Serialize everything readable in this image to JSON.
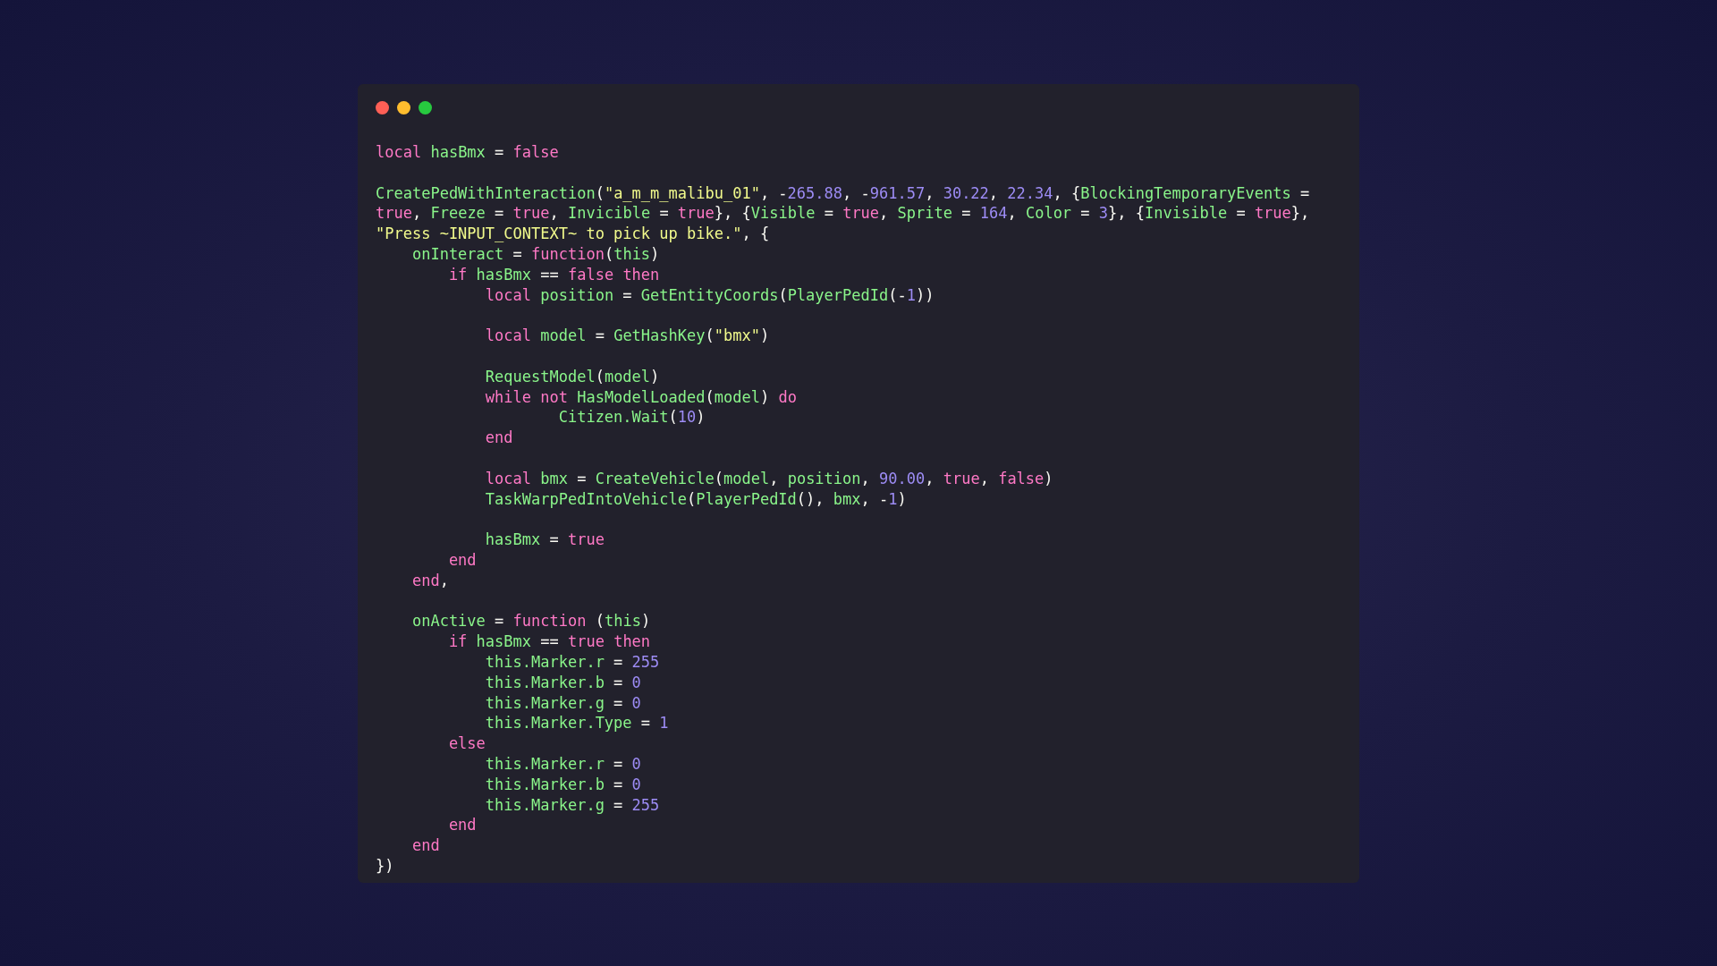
{
  "window": {
    "controls": [
      {
        "color": "#ff5f56"
      },
      {
        "color": "#ffbd2e"
      },
      {
        "color": "#27c93f"
      }
    ]
  },
  "code": {
    "blocks": [
      {
        "lines": [
          {
            "tokens": [
              {
                "kind": "kw",
                "text": "local "
              },
              {
                "kind": "id",
                "text": "hasBmx"
              },
              {
                "kind": "op",
                "text": " = "
              },
              {
                "kind": "kw",
                "text": "false"
              }
            ]
          }
        ]
      },
      {
        "lines": [
          {
            "tokens": [
              {
                "kind": "id",
                "text": "CreatePedWithInteraction"
              },
              {
                "kind": "op",
                "text": "("
              },
              {
                "kind": "str",
                "text": "\"a_m_m_malibu_01\""
              },
              {
                "kind": "op",
                "text": ", -"
              },
              {
                "kind": "num",
                "text": "265.88"
              },
              {
                "kind": "op",
                "text": ", -"
              },
              {
                "kind": "num",
                "text": "961.57"
              },
              {
                "kind": "op",
                "text": ", "
              },
              {
                "kind": "num",
                "text": "30.22"
              },
              {
                "kind": "op",
                "text": ", "
              },
              {
                "kind": "num",
                "text": "22.34"
              },
              {
                "kind": "op",
                "text": ", {"
              },
              {
                "kind": "id",
                "text": "BlockingTemporaryEvents"
              },
              {
                "kind": "op",
                "text": " ="
              }
            ]
          },
          {
            "tokens": [
              {
                "kind": "kw",
                "text": "true"
              },
              {
                "kind": "op",
                "text": ", "
              },
              {
                "kind": "id",
                "text": "Freeze"
              },
              {
                "kind": "op",
                "text": " = "
              },
              {
                "kind": "kw",
                "text": "true"
              },
              {
                "kind": "op",
                "text": ", "
              },
              {
                "kind": "id",
                "text": "Invicible"
              },
              {
                "kind": "op",
                "text": " = "
              },
              {
                "kind": "kw",
                "text": "true"
              },
              {
                "kind": "op",
                "text": "}, {"
              },
              {
                "kind": "id",
                "text": "Visible"
              },
              {
                "kind": "op",
                "text": " = "
              },
              {
                "kind": "kw",
                "text": "true"
              },
              {
                "kind": "op",
                "text": ", "
              },
              {
                "kind": "id",
                "text": "Sprite"
              },
              {
                "kind": "op",
                "text": " = "
              },
              {
                "kind": "num",
                "text": "164"
              },
              {
                "kind": "op",
                "text": ", "
              },
              {
                "kind": "id",
                "text": "Color"
              },
              {
                "kind": "op",
                "text": " = "
              },
              {
                "kind": "num",
                "text": "3"
              },
              {
                "kind": "op",
                "text": "}, {"
              },
              {
                "kind": "id",
                "text": "Invisible"
              },
              {
                "kind": "op",
                "text": " = "
              },
              {
                "kind": "kw",
                "text": "true"
              },
              {
                "kind": "op",
                "text": "},"
              }
            ]
          },
          {
            "tokens": [
              {
                "kind": "str",
                "text": "\"Press ~INPUT_CONTEXT~ to pick up bike.\""
              },
              {
                "kind": "op",
                "text": ", {"
              }
            ]
          },
          {
            "tokens": [
              {
                "kind": "id",
                "text": "    onInteract"
              },
              {
                "kind": "op",
                "text": " = "
              },
              {
                "kind": "kw",
                "text": "function"
              },
              {
                "kind": "op",
                "text": "("
              },
              {
                "kind": "id",
                "text": "this"
              },
              {
                "kind": "op",
                "text": ")"
              }
            ]
          },
          {
            "tokens": [
              {
                "kind": "kw",
                "text": "        if "
              },
              {
                "kind": "id",
                "text": "hasBmx"
              },
              {
                "kind": "op",
                "text": " == "
              },
              {
                "kind": "kw",
                "text": "false then"
              }
            ]
          },
          {
            "tokens": [
              {
                "kind": "kw",
                "text": "            local "
              },
              {
                "kind": "id",
                "text": "position"
              },
              {
                "kind": "op",
                "text": " = "
              },
              {
                "kind": "id",
                "text": "GetEntityCoords"
              },
              {
                "kind": "op",
                "text": "("
              },
              {
                "kind": "id",
                "text": "PlayerPedId"
              },
              {
                "kind": "op",
                "text": "(-"
              },
              {
                "kind": "num",
                "text": "1"
              },
              {
                "kind": "op",
                "text": "))"
              }
            ]
          }
        ]
      },
      {
        "lines": [
          {
            "tokens": [
              {
                "kind": "kw",
                "text": "            local "
              },
              {
                "kind": "id",
                "text": "model"
              },
              {
                "kind": "op",
                "text": " = "
              },
              {
                "kind": "id",
                "text": "GetHashKey"
              },
              {
                "kind": "op",
                "text": "("
              },
              {
                "kind": "str",
                "text": "\"bmx\""
              },
              {
                "kind": "op",
                "text": ")"
              }
            ]
          }
        ]
      },
      {
        "lines": [
          {
            "tokens": [
              {
                "kind": "id",
                "text": "            RequestModel"
              },
              {
                "kind": "op",
                "text": "("
              },
              {
                "kind": "id",
                "text": "model"
              },
              {
                "kind": "op",
                "text": ")"
              }
            ]
          },
          {
            "tokens": [
              {
                "kind": "kw",
                "text": "            while not "
              },
              {
                "kind": "id",
                "text": "HasModelLoaded"
              },
              {
                "kind": "op",
                "text": "("
              },
              {
                "kind": "id",
                "text": "model"
              },
              {
                "kind": "op",
                "text": ") "
              },
              {
                "kind": "kw",
                "text": "do"
              }
            ]
          },
          {
            "tokens": [
              {
                "kind": "id",
                "text": "                    Citizen.Wait"
              },
              {
                "kind": "op",
                "text": "("
              },
              {
                "kind": "num",
                "text": "10"
              },
              {
                "kind": "op",
                "text": ")"
              }
            ]
          },
          {
            "tokens": [
              {
                "kind": "kw",
                "text": "            end"
              }
            ]
          }
        ]
      },
      {
        "lines": [
          {
            "tokens": [
              {
                "kind": "kw",
                "text": "            local "
              },
              {
                "kind": "id",
                "text": "bmx"
              },
              {
                "kind": "op",
                "text": " = "
              },
              {
                "kind": "id",
                "text": "CreateVehicle"
              },
              {
                "kind": "op",
                "text": "("
              },
              {
                "kind": "id",
                "text": "model"
              },
              {
                "kind": "op",
                "text": ", "
              },
              {
                "kind": "id",
                "text": "position"
              },
              {
                "kind": "op",
                "text": ", "
              },
              {
                "kind": "num",
                "text": "90.00"
              },
              {
                "kind": "op",
                "text": ", "
              },
              {
                "kind": "kw",
                "text": "true"
              },
              {
                "kind": "op",
                "text": ", "
              },
              {
                "kind": "kw",
                "text": "false"
              },
              {
                "kind": "op",
                "text": ")"
              }
            ]
          },
          {
            "tokens": [
              {
                "kind": "id",
                "text": "            TaskWarpPedIntoVehicle"
              },
              {
                "kind": "op",
                "text": "("
              },
              {
                "kind": "id",
                "text": "PlayerPedId"
              },
              {
                "kind": "op",
                "text": "(), "
              },
              {
                "kind": "id",
                "text": "bmx"
              },
              {
                "kind": "op",
                "text": ", -"
              },
              {
                "kind": "num",
                "text": "1"
              },
              {
                "kind": "op",
                "text": ")"
              }
            ]
          }
        ]
      },
      {
        "lines": [
          {
            "tokens": [
              {
                "kind": "id",
                "text": "            hasBmx"
              },
              {
                "kind": "op",
                "text": " = "
              },
              {
                "kind": "kw",
                "text": "true"
              }
            ]
          },
          {
            "tokens": [
              {
                "kind": "kw",
                "text": "        end"
              }
            ]
          },
          {
            "tokens": [
              {
                "kind": "kw",
                "text": "    end"
              },
              {
                "kind": "op",
                "text": ","
              }
            ]
          }
        ]
      },
      {
        "lines": [
          {
            "tokens": [
              {
                "kind": "id",
                "text": "    onActive"
              },
              {
                "kind": "op",
                "text": " = "
              },
              {
                "kind": "kw",
                "text": "function"
              },
              {
                "kind": "op",
                "text": " ("
              },
              {
                "kind": "id",
                "text": "this"
              },
              {
                "kind": "op",
                "text": ")"
              }
            ]
          },
          {
            "tokens": [
              {
                "kind": "kw",
                "text": "        if "
              },
              {
                "kind": "id",
                "text": "hasBmx"
              },
              {
                "kind": "op",
                "text": " == "
              },
              {
                "kind": "kw",
                "text": "true then"
              }
            ]
          },
          {
            "tokens": [
              {
                "kind": "id",
                "text": "            this.Marker.r"
              },
              {
                "kind": "op",
                "text": " = "
              },
              {
                "kind": "num",
                "text": "255"
              }
            ]
          },
          {
            "tokens": [
              {
                "kind": "id",
                "text": "            this.Marker.b"
              },
              {
                "kind": "op",
                "text": " = "
              },
              {
                "kind": "num",
                "text": "0"
              }
            ]
          },
          {
            "tokens": [
              {
                "kind": "id",
                "text": "            this.Marker.g"
              },
              {
                "kind": "op",
                "text": " = "
              },
              {
                "kind": "num",
                "text": "0"
              }
            ]
          },
          {
            "tokens": [
              {
                "kind": "id",
                "text": "            this.Marker.Type"
              },
              {
                "kind": "op",
                "text": " = "
              },
              {
                "kind": "num",
                "text": "1"
              }
            ]
          },
          {
            "tokens": [
              {
                "kind": "kw",
                "text": "        else"
              }
            ]
          },
          {
            "tokens": [
              {
                "kind": "id",
                "text": "            this.Marker.r"
              },
              {
                "kind": "op",
                "text": " = "
              },
              {
                "kind": "num",
                "text": "0"
              }
            ]
          },
          {
            "tokens": [
              {
                "kind": "id",
                "text": "            this.Marker.b"
              },
              {
                "kind": "op",
                "text": " = "
              },
              {
                "kind": "num",
                "text": "0"
              }
            ]
          },
          {
            "tokens": [
              {
                "kind": "id",
                "text": "            this.Marker.g"
              },
              {
                "kind": "op",
                "text": " = "
              },
              {
                "kind": "num",
                "text": "255"
              }
            ]
          },
          {
            "tokens": [
              {
                "kind": "kw",
                "text": "        end"
              }
            ]
          },
          {
            "tokens": [
              {
                "kind": "kw",
                "text": "    end"
              }
            ]
          },
          {
            "tokens": [
              {
                "kind": "op",
                "text": "})"
              }
            ]
          }
        ]
      }
    ]
  }
}
